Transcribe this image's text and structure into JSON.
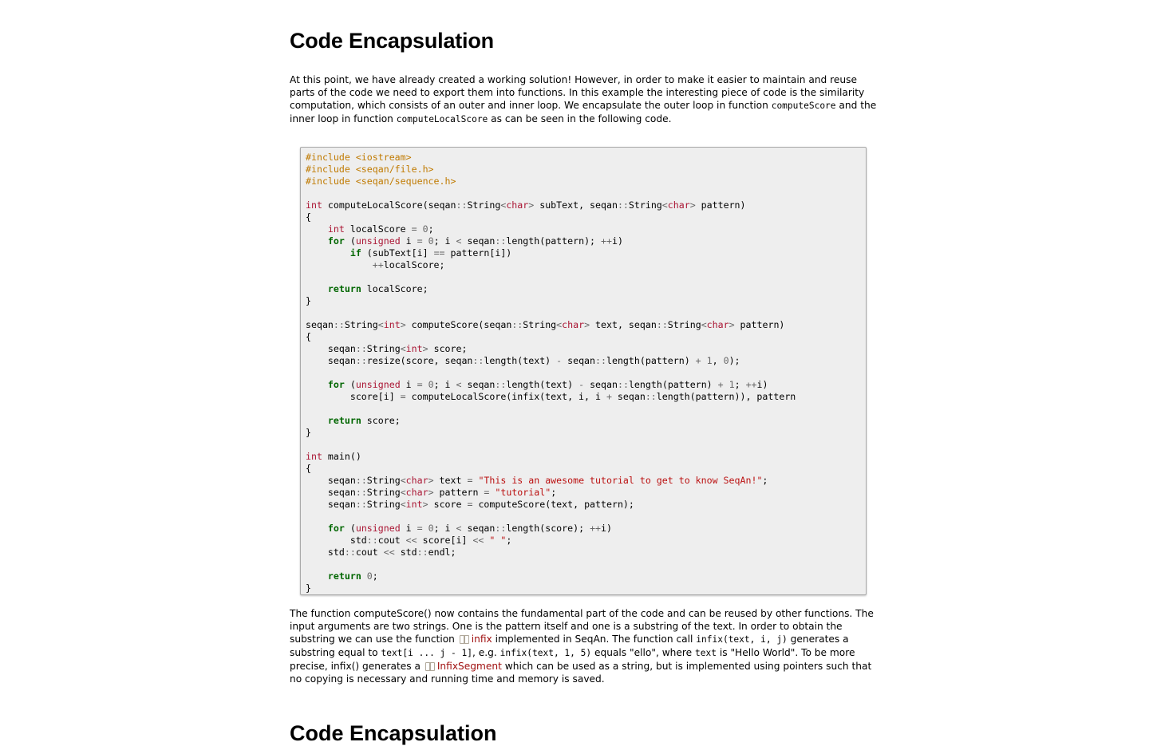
{
  "title": "Code Encapsulation",
  "intro": {
    "t1": "At this point, we have already created a working solution! However, in order to make it easier to maintain and reuse parts of the code we need to export them into functions. In this example the interesting piece of code is the similarity computation, which consists of an outer and inner loop. We encapsulate the outer loop in function ",
    "c1": "computeScore",
    "t2": " and the inner loop in function ",
    "c2": "computeLocalScore",
    "t3": " as can be seen in the following code."
  },
  "code_lines": [
    "#include <iostream>",
    "#include <seqan/file.h>",
    "#include <seqan/sequence.h>",
    "",
    "int computeLocalScore(seqan::String<char> subText, seqan::String<char> pattern)",
    "{",
    "    int localScore = 0;",
    "    for (unsigned i = 0; i < seqan::length(pattern); ++i)",
    "        if (subText[i] == pattern[i])",
    "            ++localScore;",
    "",
    "    return localScore;",
    "}",
    "",
    "seqan::String<int> computeScore(seqan::String<char> text, seqan::String<char> pattern)",
    "{",
    "    seqan::String<int> score;",
    "    seqan::resize(score, seqan::length(text) - seqan::length(pattern) + 1, 0);",
    "",
    "    for (unsigned i = 0; i < seqan::length(text) - seqan::length(pattern) + 1; ++i)",
    "        score[i] = computeLocalScore(infix(text, i, i + seqan::length(pattern)), pattern",
    "",
    "    return score;",
    "}",
    "",
    "int main()",
    "{",
    "    seqan::String<char> text = \"This is an awesome tutorial to get to know SeqAn!\";",
    "    seqan::String<char> pattern = \"tutorial\";",
    "    seqan::String<int> score = computeScore(text, pattern);",
    "",
    "    for (unsigned i = 0; i < seqan::length(score); ++i)",
    "        std::cout << score[i] << \" \";",
    "    std::cout << std::endl;",
    "",
    "    return 0;",
    "}"
  ],
  "outro": {
    "t1": "The function computeScore() now contains the fundamental part of the code and can be reused by other functions. The input arguments are two strings. One is the pattern itself and one is a substring of the text. In order to obtain the substring we can use the function ",
    "link1": "infix",
    "t2": " implemented in SeqAn. The function call ",
    "c1": "infix(text, i, j)",
    "t3": " generates a substring equal to ",
    "c2": "text[i ... j - 1]",
    "t4": ", e.g. ",
    "c3": "infix(text, 1, 5)",
    "t5": " equals \"ello\", where ",
    "c4": "text",
    "t6": " is \"Hello World\". To be more precise, infix() generates a ",
    "link2": "InfixSegment",
    "t7": " which can be used as a string, but is implemented using pointers such that no copying is necessary and running time and memory is saved."
  },
  "next_heading": "Code Encapsulation"
}
